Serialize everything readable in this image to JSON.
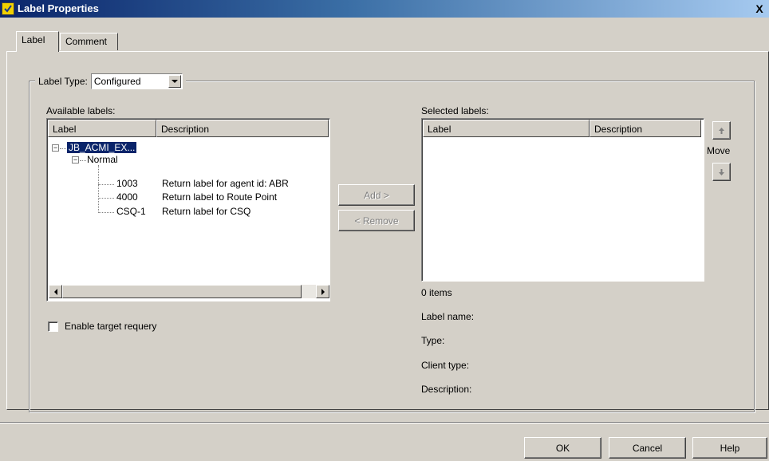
{
  "window": {
    "title": "Label Properties",
    "close_label": "X"
  },
  "tabs": [
    {
      "label": "Label",
      "active": true
    },
    {
      "label": "Comment",
      "active": false
    }
  ],
  "label_type": {
    "label": "Label Type:",
    "value": "Configured"
  },
  "available": {
    "heading": "Available labels:",
    "columns": [
      "Label",
      "Description"
    ],
    "tree": {
      "root": "JB_ACMI_EX...",
      "group": "Normal",
      "items": [
        {
          "label": "1003",
          "description": "Return label for agent id: ABR"
        },
        {
          "label": "4000",
          "description": "Return label to Route Point"
        },
        {
          "label": "CSQ-1",
          "description": "Return label for CSQ"
        }
      ]
    }
  },
  "actions": {
    "add": "Add >",
    "remove": "< Remove"
  },
  "selected": {
    "heading": "Selected labels:",
    "columns": [
      "Label",
      "Description"
    ],
    "count": "0 items",
    "move_label": "Move"
  },
  "details": {
    "label_name": "Label name:",
    "type": "Type:",
    "client_type": "Client type:",
    "description": "Description:"
  },
  "enable_requery": {
    "label": "Enable target requery",
    "checked": false
  },
  "footer": {
    "ok": "OK",
    "cancel": "Cancel",
    "help": "Help"
  },
  "colors": {
    "titlebar_start": "#0a246a",
    "titlebar_end": "#a6caf0",
    "dialog_bg": "#d4d0c8",
    "selection": "#0a246a"
  }
}
